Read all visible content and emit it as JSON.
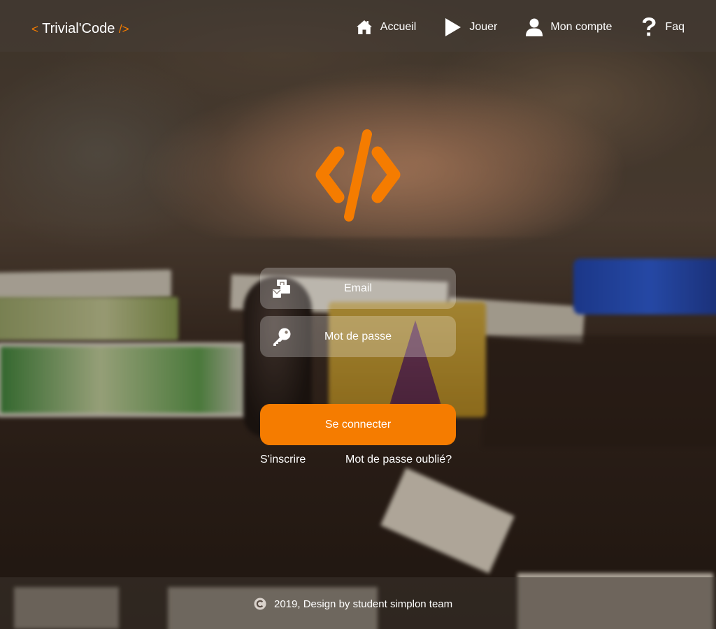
{
  "header": {
    "logo": {
      "open": "<",
      "name": "Trivial'Code",
      "close": "/>"
    },
    "nav": [
      {
        "label": "Accueil",
        "icon": "home-icon"
      },
      {
        "label": "Jouer",
        "icon": "play-icon"
      },
      {
        "label": "Mon compte",
        "icon": "user-icon"
      },
      {
        "label": "Faq",
        "icon": "question-icon"
      }
    ]
  },
  "hero": {
    "icon": "code-logo-icon"
  },
  "form": {
    "email": {
      "placeholder": "Email",
      "value": "",
      "icon": "email-icon"
    },
    "password": {
      "placeholder": "Mot de passe",
      "value": "",
      "icon": "key-icon"
    },
    "submit_label": "Se connecter",
    "register_label": "S'inscrire",
    "forgot_label": "Mot de passe oublié?"
  },
  "footer": {
    "icon": "copyright-icon",
    "text": "2019, Design by student simplon team"
  },
  "colors": {
    "accent": "#f57c00",
    "text": "#ffffff"
  }
}
